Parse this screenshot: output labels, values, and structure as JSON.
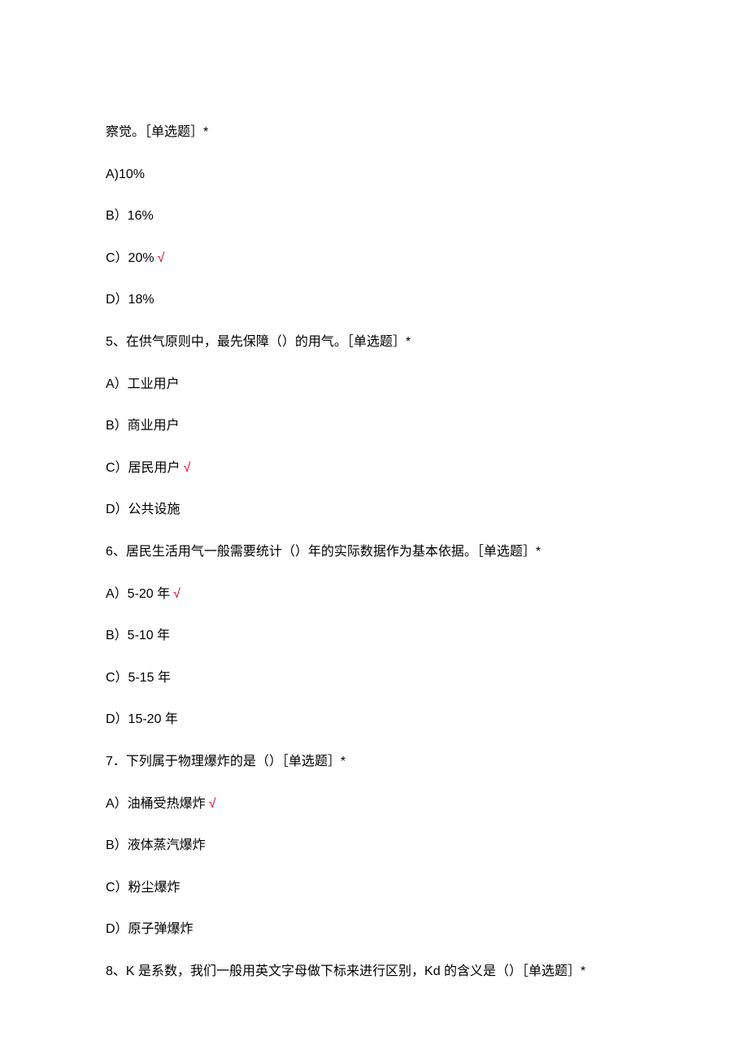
{
  "fragment": {
    "trailing": "察觉。［单选题］*",
    "options": [
      {
        "label": "A)10%",
        "correct": false
      },
      {
        "label": "B）16%",
        "correct": false
      },
      {
        "label": "C）20%",
        "correct": true
      },
      {
        "label": "D）18%",
        "correct": false
      }
    ]
  },
  "questions": [
    {
      "stem": "5、在供气原则中，最先保障（）的用气。［单选题］*",
      "options": [
        {
          "label": "A）工业用户",
          "correct": false
        },
        {
          "label": "B）商业用户",
          "correct": false
        },
        {
          "label": "C）居民用户",
          "correct": true
        },
        {
          "label": "D）公共设施",
          "correct": false
        }
      ]
    },
    {
      "stem": "6、居民生活用气一般需要统计（）年的实际数据作为基本依据。［单选题］*",
      "options": [
        {
          "label": "A）5-20 年",
          "correct": true
        },
        {
          "label": "B）5-10 年",
          "correct": false
        },
        {
          "label": "C）5-15 年",
          "correct": false
        },
        {
          "label": "D）15-20 年",
          "correct": false
        }
      ]
    },
    {
      "stem": "7．下列属于物理爆炸的是（）［单选题］*",
      "options": [
        {
          "label": "A）油桶受热爆炸",
          "correct": true
        },
        {
          "label": "B）液体蒸汽爆炸",
          "correct": false
        },
        {
          "label": "C）粉尘爆炸",
          "correct": false
        },
        {
          "label": "D）原子弹爆炸",
          "correct": false
        }
      ]
    }
  ],
  "trailing_question": "8、K 是系数，我们一般用英文字母做下标来进行区别，Kd 的含义是（）［单选题］*",
  "checkmark": "√"
}
